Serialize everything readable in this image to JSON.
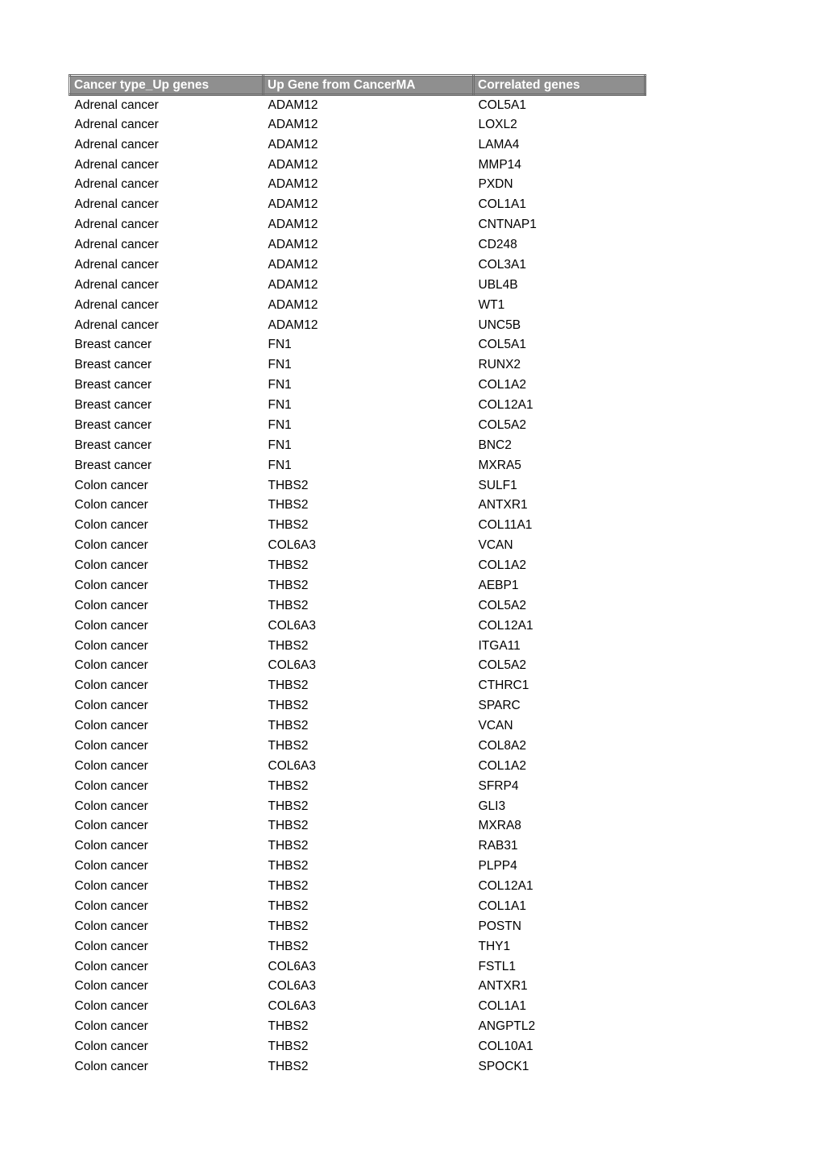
{
  "table": {
    "headers": [
      "Cancer type_Up genes",
      "Up Gene from CancerMA",
      "Correlated genes"
    ],
    "header_bg": "#8f8f8f",
    "rows": [
      [
        "Adrenal cancer",
        "ADAM12",
        "COL5A1"
      ],
      [
        "Adrenal cancer",
        "ADAM12",
        "LOXL2"
      ],
      [
        "Adrenal cancer",
        "ADAM12",
        "LAMA4"
      ],
      [
        "Adrenal cancer",
        "ADAM12",
        "MMP14"
      ],
      [
        "Adrenal cancer",
        "ADAM12",
        "PXDN"
      ],
      [
        "Adrenal cancer",
        "ADAM12",
        "COL1A1"
      ],
      [
        "Adrenal cancer",
        "ADAM12",
        "CNTNAP1"
      ],
      [
        "Adrenal cancer",
        "ADAM12",
        "CD248"
      ],
      [
        "Adrenal cancer",
        "ADAM12",
        "COL3A1"
      ],
      [
        "Adrenal cancer",
        "ADAM12",
        "UBL4B"
      ],
      [
        "Adrenal cancer",
        "ADAM12",
        "WT1"
      ],
      [
        "Adrenal cancer",
        "ADAM12",
        "UNC5B"
      ],
      [
        "Breast cancer",
        "FN1",
        "COL5A1"
      ],
      [
        "Breast cancer",
        "FN1",
        "RUNX2"
      ],
      [
        "Breast cancer",
        "FN1",
        "COL1A2"
      ],
      [
        "Breast cancer",
        "FN1",
        "COL12A1"
      ],
      [
        "Breast cancer",
        "FN1",
        "COL5A2"
      ],
      [
        "Breast cancer",
        "FN1",
        "BNC2"
      ],
      [
        "Breast cancer",
        "FN1",
        "MXRA5"
      ],
      [
        "Colon cancer",
        "THBS2",
        "SULF1"
      ],
      [
        "Colon cancer",
        "THBS2",
        "ANTXR1"
      ],
      [
        "Colon cancer",
        "THBS2",
        "COL11A1"
      ],
      [
        "Colon cancer",
        "COL6A3",
        "VCAN"
      ],
      [
        "Colon cancer",
        "THBS2",
        "COL1A2"
      ],
      [
        "Colon cancer",
        "THBS2",
        "AEBP1"
      ],
      [
        "Colon cancer",
        "THBS2",
        "COL5A2"
      ],
      [
        "Colon cancer",
        "COL6A3",
        "COL12A1"
      ],
      [
        "Colon cancer",
        "THBS2",
        "ITGA11"
      ],
      [
        "Colon cancer",
        "COL6A3",
        "COL5A2"
      ],
      [
        "Colon cancer",
        "THBS2",
        "CTHRC1"
      ],
      [
        "Colon cancer",
        "THBS2",
        "SPARC"
      ],
      [
        "Colon cancer",
        "THBS2",
        "VCAN"
      ],
      [
        "Colon cancer",
        "THBS2",
        "COL8A2"
      ],
      [
        "Colon cancer",
        "COL6A3",
        "COL1A2"
      ],
      [
        "Colon cancer",
        "THBS2",
        "SFRP4"
      ],
      [
        "Colon cancer",
        "THBS2",
        "GLI3"
      ],
      [
        "Colon cancer",
        "THBS2",
        "MXRA8"
      ],
      [
        "Colon cancer",
        "THBS2",
        "RAB31"
      ],
      [
        "Colon cancer",
        "THBS2",
        "PLPP4"
      ],
      [
        "Colon cancer",
        "THBS2",
        "COL12A1"
      ],
      [
        "Colon cancer",
        "THBS2",
        "COL1A1"
      ],
      [
        "Colon cancer",
        "THBS2",
        "POSTN"
      ],
      [
        "Colon cancer",
        "THBS2",
        "THY1"
      ],
      [
        "Colon cancer",
        "COL6A3",
        "FSTL1"
      ],
      [
        "Colon cancer",
        "COL6A3",
        "ANTXR1"
      ],
      [
        "Colon cancer",
        "COL6A3",
        "COL1A1"
      ],
      [
        "Colon cancer",
        "THBS2",
        "ANGPTL2"
      ],
      [
        "Colon cancer",
        "THBS2",
        "COL10A1"
      ],
      [
        "Colon cancer",
        "THBS2",
        "SPOCK1"
      ]
    ]
  }
}
